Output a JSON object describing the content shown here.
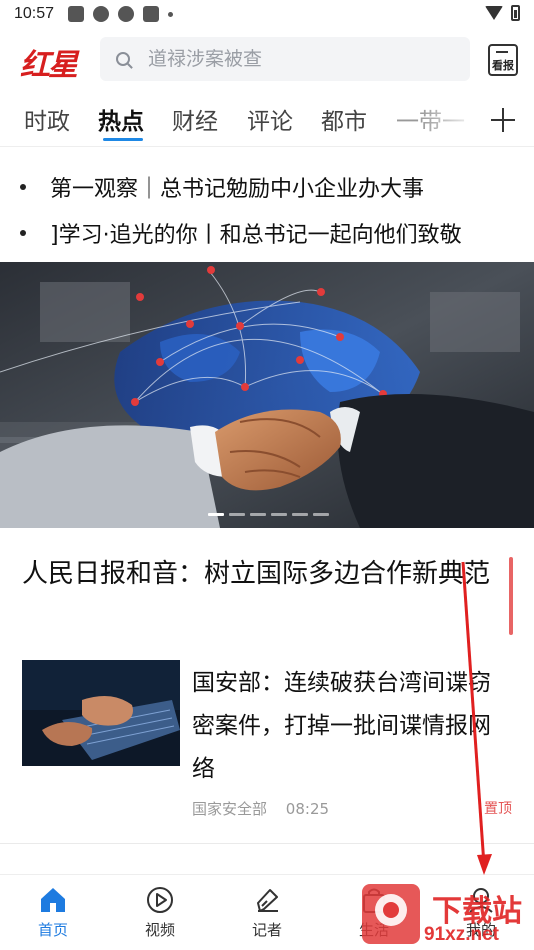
{
  "status_bar": {
    "time": "10:57"
  },
  "header": {
    "logo": "红星",
    "search_placeholder": "道禄涉案被查",
    "paper_label": "看报"
  },
  "tabs": [
    {
      "label": "时政",
      "active": false
    },
    {
      "label": "热点",
      "active": true
    },
    {
      "label": "财经",
      "active": false
    },
    {
      "label": "评论",
      "active": false
    },
    {
      "label": "都市",
      "active": false
    },
    {
      "label": "一带一",
      "active": false
    }
  ],
  "ticker": [
    "第一观察｜总书记勉励中小企业办大事",
    "]学习·追光的你丨和总书记一起向他们致敬"
  ],
  "banner": {
    "slide_count": 6,
    "active_slide": 1
  },
  "headline": "人民日报和音：树立国际多边合作新典范",
  "news": {
    "title": "国安部：连续破获台湾间谍窃密案件，打掉一批间谍情报网络",
    "source": "国家安全部",
    "time": "08:25",
    "badge": "置顶"
  },
  "bottom_nav": [
    {
      "label": "首页",
      "icon": "home-icon",
      "active": true
    },
    {
      "label": "视频",
      "icon": "play-icon",
      "active": false
    },
    {
      "label": "记者",
      "icon": "pen-icon",
      "active": false
    },
    {
      "label": "生活",
      "icon": "bag-icon",
      "active": false
    },
    {
      "label": "我的",
      "icon": "user-icon",
      "active": false
    }
  ],
  "watermark": {
    "text": "下载站",
    "url_text": "91xz.net"
  },
  "colors": {
    "accent": "#1e88e5",
    "brand_red": "#d71f1f",
    "pin_red": "#e45555"
  }
}
